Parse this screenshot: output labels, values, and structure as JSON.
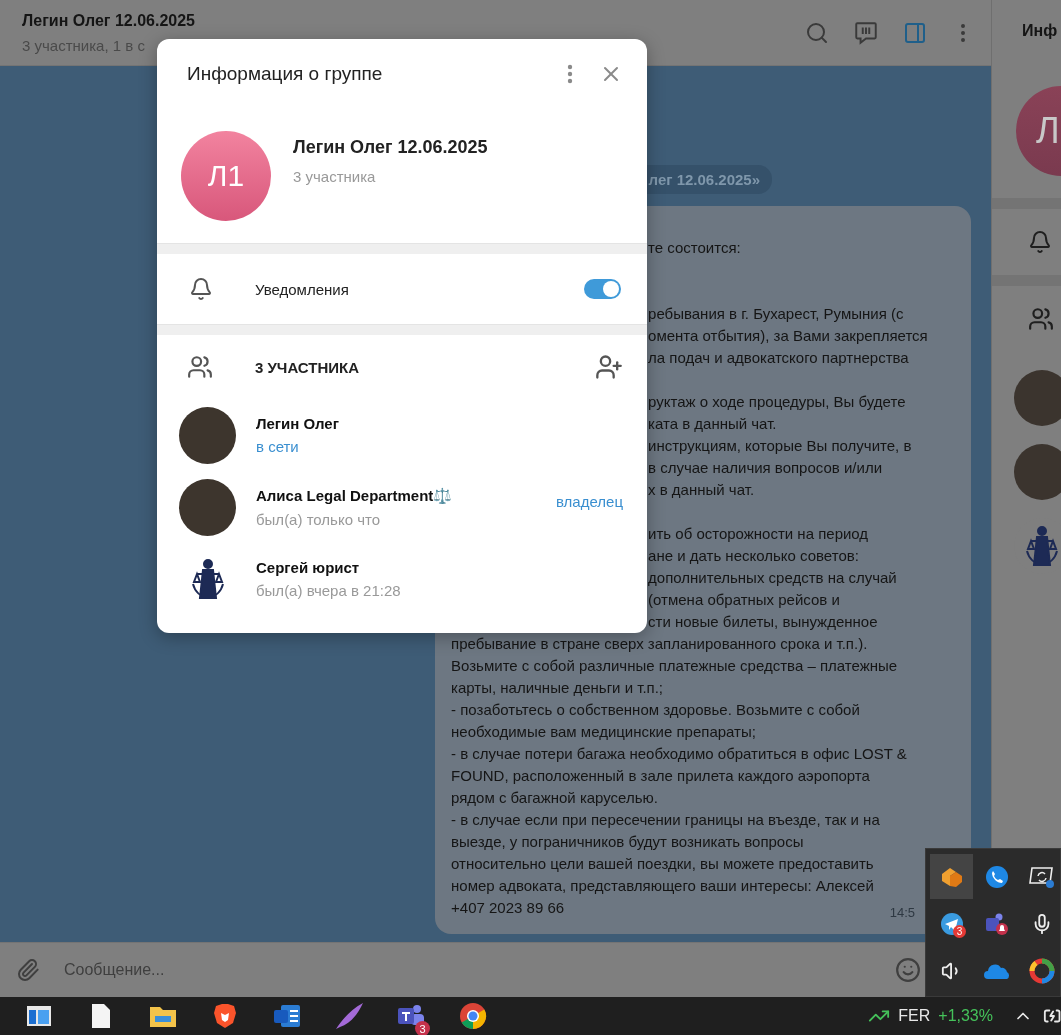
{
  "chat": {
    "title": "Легин Олег 12.06.2025",
    "subtitle": "3 участника, 1 в с",
    "header_icons": [
      {
        "kind": "search",
        "active": false
      },
      {
        "kind": "bars",
        "active": false
      },
      {
        "kind": "sidebar",
        "active": true
      },
      {
        "kind": "more",
        "active": false
      }
    ],
    "service_message": "лег 12.06.2025»",
    "message": {
      "lines": [
        {
          "kind": "partial",
          "text": "те состоится:"
        },
        {
          "kind": "gap"
        },
        {
          "kind": "gap"
        },
        {
          "kind": "partial",
          "text": "ребывания в г. Бухарест, Румыния (с"
        },
        {
          "kind": "partial",
          "text": "омента отбытия), за Вами закрепляется"
        },
        {
          "kind": "partial",
          "text": "ла подач и адвокатского партнерства"
        },
        {
          "kind": "gap"
        },
        {
          "kind": "partial",
          "text": "руктаж о ходе процедуры, Вы будете"
        },
        {
          "kind": "partial",
          "text": "ката в данный чат."
        },
        {
          "kind": "partial",
          "text": "инструкциям, которые Вы получите, в"
        },
        {
          "kind": "partial",
          "text": "в случае наличия вопросов и/или"
        },
        {
          "kind": "partial",
          "text": "х в данный чат."
        },
        {
          "kind": "gap"
        },
        {
          "kind": "partial",
          "text": "ить об осторожности на период"
        },
        {
          "kind": "partial",
          "text": "ане и дать несколько советов:"
        },
        {
          "kind": "partial",
          "text": "дополнительных средств на случай"
        },
        {
          "kind": "partial",
          "text": "(отмена обратных рейсов и"
        },
        {
          "kind": "partial",
          "text": "сти новые билеты, вынужденное"
        },
        {
          "kind": "full",
          "text": "пребывание в стране сверх запланированного срока и т.п.)."
        },
        {
          "kind": "full",
          "text": "Возьмите с собой различные платежные средства – платежные"
        },
        {
          "kind": "full",
          "text": "карты, наличные деньги и т.п.;"
        },
        {
          "kind": "full",
          "text": "- позаботьтесь о собственном здоровье. Возьмите с собой"
        },
        {
          "kind": "full",
          "text": "необходимые вам медицинские препараты;"
        },
        {
          "kind": "full",
          "text": "- в случае потери багажа необходимо обратиться в офис LOST &"
        },
        {
          "kind": "full",
          "text": "FOUND, расположенный в зале прилета каждого аэропорта"
        },
        {
          "kind": "full",
          "text": "рядом с багажной каруселью."
        },
        {
          "kind": "full",
          "text": "- в случае если при пересечении границы на въезде, так и на"
        },
        {
          "kind": "full",
          "text": "выезде, у пограничников будут возникать вопросы"
        },
        {
          "kind": "full",
          "text": "относительно цели вашей поездки, вы можете предоставить"
        },
        {
          "kind": "full",
          "text": "номер адвоката, представляющего ваши интересы: Алексей"
        },
        {
          "kind": "full",
          "text": "+407 2023 89 66"
        }
      ],
      "time": "14:5"
    },
    "composer": {
      "placeholder": "Сообщение..."
    }
  },
  "side_panel": {
    "title": "Инф",
    "avatar_letter": "Л",
    "avatars": [
      {
        "kind": "photo"
      },
      {
        "kind": "photo"
      },
      {
        "kind": "emblem"
      }
    ]
  },
  "dialog": {
    "title": "Информация о группе",
    "avatar_initials": "Л1",
    "name": "Легин Олег 12.06.2025",
    "subtitle": "3 участника",
    "notifications": {
      "label": "Уведомления",
      "on": true
    },
    "members_header": "3 УЧАСТНИКА",
    "members": [
      {
        "kind": "photo",
        "name": "Легин Олег",
        "status": "в сети",
        "online": true
      },
      {
        "kind": "photo",
        "name": "Алиса Legal Department⚖️",
        "status": "был(а) только что",
        "online": false,
        "role": "владелец"
      },
      {
        "kind": "emblem",
        "name": "Сергей юрист",
        "status": "был(а) вчера в 21:28",
        "online": false
      }
    ]
  },
  "taskbar": {
    "apps": [
      {
        "kind": "window"
      },
      {
        "kind": "document"
      },
      {
        "kind": "folder"
      },
      {
        "kind": "shield"
      },
      {
        "kind": "word"
      },
      {
        "kind": "feather"
      },
      {
        "kind": "teams",
        "badge": "3"
      },
      {
        "kind": "chrome"
      }
    ],
    "stock": {
      "ticker": "FER",
      "change": "+1,33%"
    }
  },
  "tray": {
    "items": [
      {
        "kind": "hexagon",
        "hovered": true
      },
      {
        "kind": "phone",
        "hovered": false
      },
      {
        "kind": "screen",
        "hovered": false
      },
      {
        "kind": "plane",
        "hovered": false,
        "badge": "3"
      },
      {
        "kind": "teams",
        "hovered": false
      },
      {
        "kind": "mic",
        "hovered": false
      },
      {
        "kind": "speaker",
        "hovered": false
      },
      {
        "kind": "cloud",
        "hovered": false
      },
      {
        "kind": "ring",
        "hovered": false
      }
    ]
  }
}
